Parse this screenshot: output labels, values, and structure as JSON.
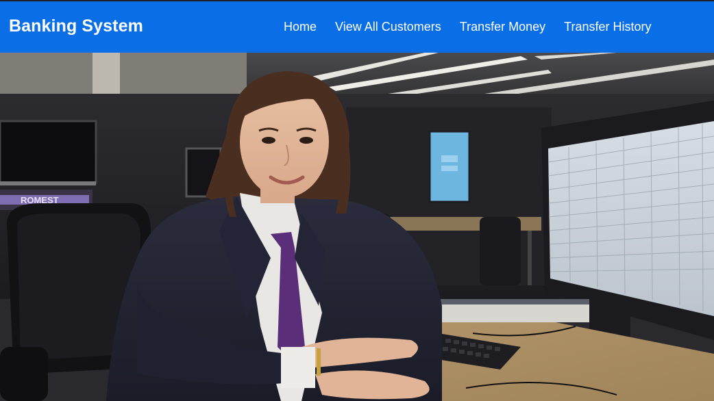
{
  "navbar": {
    "brand": "Banking System",
    "links": [
      {
        "label": "Home"
      },
      {
        "label": "View All Customers"
      },
      {
        "label": "Transfer Money"
      },
      {
        "label": "Transfer History"
      }
    ],
    "background": "#0a6fe6"
  },
  "hero": {
    "image_description": "banker-at-desk-photo",
    "monitor_sign_text": "ROMEST"
  }
}
